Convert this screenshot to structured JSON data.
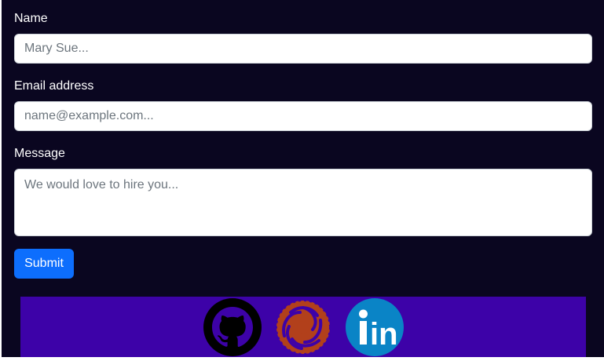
{
  "form": {
    "name": {
      "label": "Name",
      "placeholder": "Mary Sue..."
    },
    "email": {
      "label": "Email address",
      "placeholder": "name@example.com..."
    },
    "message": {
      "label": "Message",
      "placeholder": "We would love to hire you..."
    },
    "submit_label": "Submit"
  },
  "social": {
    "background": "#3d02a8",
    "links": [
      {
        "icon": "github-icon",
        "color": "#000000"
      },
      {
        "icon": "elixir-ring-icon",
        "color": "#b2401b"
      },
      {
        "icon": "linkedin-icon",
        "color": "#0a84c6"
      },
      {
        "icon": "",
        "text": "in"
      }
    ]
  }
}
